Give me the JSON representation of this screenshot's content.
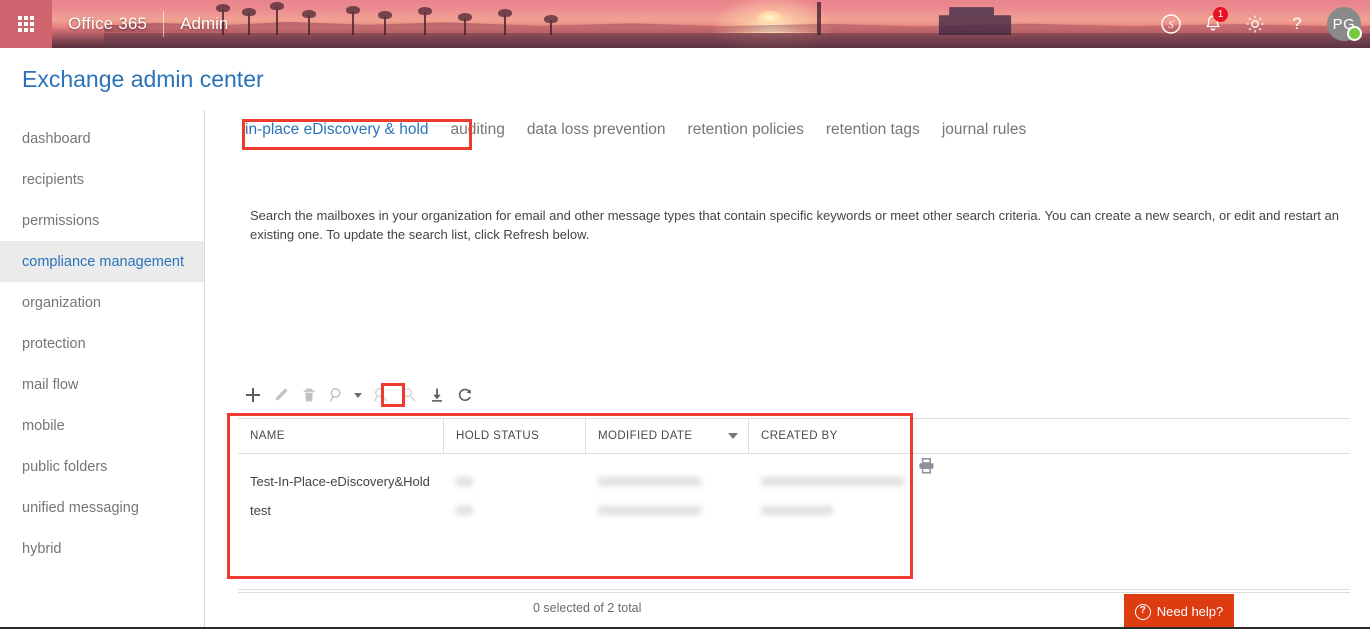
{
  "suite_bar": {
    "waffle_label": "app launcher",
    "brand": "Office 365",
    "app_name": "Admin",
    "icons": [
      {
        "name": "skype-icon",
        "label": "Skype for Business"
      },
      {
        "name": "notifications-icon",
        "label": "Notifications",
        "badge": "1"
      },
      {
        "name": "settings-gear-icon",
        "label": "Settings"
      },
      {
        "name": "help-question-icon",
        "label": "Help"
      }
    ],
    "avatar_initials": "PG",
    "presence_color": "#7ac943",
    "badge_color": "#e81123"
  },
  "header": {
    "title": "Exchange admin center",
    "title_color": "#2b72b8"
  },
  "sidebar": {
    "items": [
      {
        "label": "dashboard",
        "selected": false
      },
      {
        "label": "recipients",
        "selected": false
      },
      {
        "label": "permissions",
        "selected": false
      },
      {
        "label": "compliance management",
        "selected": true
      },
      {
        "label": "organization",
        "selected": false
      },
      {
        "label": "protection",
        "selected": false
      },
      {
        "label": "mail flow",
        "selected": false
      },
      {
        "label": "mobile",
        "selected": false
      },
      {
        "label": "public folders",
        "selected": false
      },
      {
        "label": "unified messaging",
        "selected": false
      },
      {
        "label": "hybrid",
        "selected": false
      }
    ]
  },
  "tabs": [
    {
      "label": "in-place eDiscovery & hold",
      "active": true
    },
    {
      "label": "auditing",
      "active": false
    },
    {
      "label": "data loss prevention",
      "active": false
    },
    {
      "label": "retention policies",
      "active": false
    },
    {
      "label": "retention tags",
      "active": false
    },
    {
      "label": "journal rules",
      "active": false
    }
  ],
  "description": "Search the mailboxes in your organization for email and other message types that contain specific keywords or meet other search criteria. You can create a new search, or edit and restart an existing one. To update the search list, click Refresh below.",
  "toolbar": [
    {
      "name": "add-new-icon",
      "title": "New",
      "enabled": true,
      "highlighted": false
    },
    {
      "name": "edit-pencil-icon",
      "title": "Edit",
      "enabled": false,
      "highlighted": false
    },
    {
      "name": "delete-trash-icon",
      "title": "Delete",
      "enabled": false,
      "highlighted": false
    },
    {
      "name": "search-magnifier-icon",
      "title": "Search",
      "enabled": false,
      "highlighted": false
    },
    {
      "name": "search-estimate-icon",
      "title": "Estimate search results",
      "enabled": false,
      "highlighted": false
    },
    {
      "name": "search-preview-icon",
      "title": "Preview search results",
      "enabled": false,
      "highlighted": false
    },
    {
      "name": "export-download-icon",
      "title": "Export to a PST file",
      "enabled": true,
      "highlighted": true
    },
    {
      "name": "refresh-icon",
      "title": "Refresh",
      "enabled": true,
      "highlighted": false
    }
  ],
  "table": {
    "columns": [
      {
        "label": "NAME",
        "sorted": false
      },
      {
        "label": "HOLD STATUS",
        "sorted": false
      },
      {
        "label": "MODIFIED DATE",
        "sorted": true,
        "sort_direction": "descending"
      },
      {
        "label": "CREATED BY",
        "sorted": false
      }
    ],
    "rows": [
      {
        "name": "Test-In-Place-eDiscovery&Hold",
        "hold_status": "",
        "modified_date": "",
        "created_by": ""
      },
      {
        "name": "test",
        "hold_status": "",
        "modified_date": "",
        "created_by": ""
      }
    ],
    "row_action_icon": "printer-icon"
  },
  "status": {
    "selection_text": "0 selected of 2 total"
  },
  "need_help": {
    "label": "Need help?",
    "background": "#dd3c10"
  },
  "annotations": [
    {
      "name": "annotation-tab-highlight",
      "target": "in-place eDiscovery & hold tab",
      "color": "#ee3b2f"
    },
    {
      "name": "annotation-export-icon-highlight",
      "target": "export toolbar icon",
      "color": "#ee3b2f"
    },
    {
      "name": "annotation-table-highlight",
      "target": "search results table",
      "color": "#ee3b2f"
    }
  ]
}
